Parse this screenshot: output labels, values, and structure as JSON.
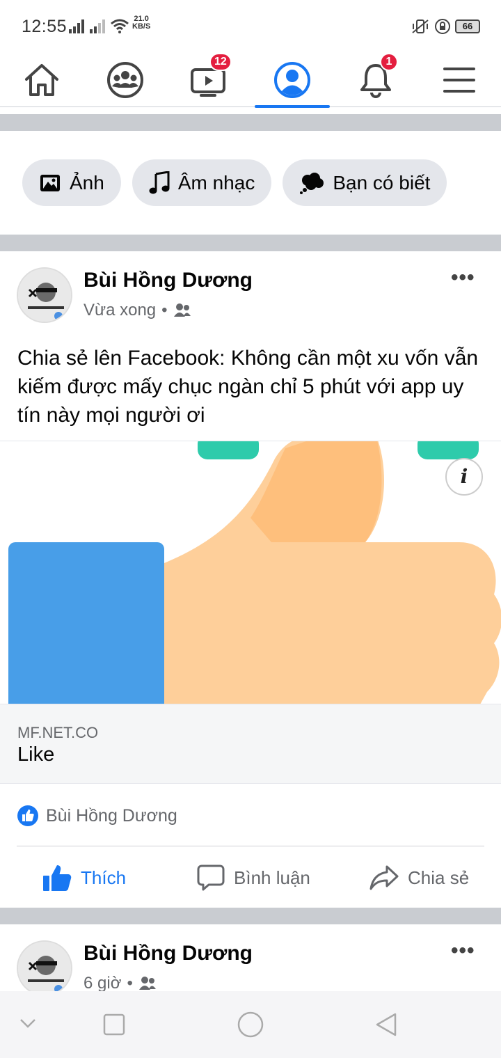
{
  "status_bar": {
    "time": "12:55",
    "speed_value": "21.0",
    "speed_unit": "KB/S",
    "battery": "66"
  },
  "nav": {
    "video_badge": "12",
    "notifications_badge": "1"
  },
  "chips": [
    {
      "label": "Ảnh"
    },
    {
      "label": "Âm nhạc"
    },
    {
      "label": "Bạn có biết"
    }
  ],
  "post": {
    "author": "Bùi Hồng Dương",
    "time": "Vừa xong",
    "text": "Chia sẻ lên Facebook: Không cần một xu vốn vẫn kiếm được mấy chục ngàn chỉ 5 phút với app uy tín này mọi người ơi",
    "link_domain": "MF.NET.CO",
    "link_title": "Like",
    "reaction_name": "Bùi Hồng Dương",
    "actions": {
      "like": "Thích",
      "comment": "Bình luận",
      "share": "Chia sẻ"
    }
  },
  "post2": {
    "author": "Bùi Hồng Dương",
    "time": "6 giờ"
  },
  "colors": {
    "accent": "#1877f2",
    "badge": "#e41e3f",
    "separator": "#c9ccd1"
  }
}
